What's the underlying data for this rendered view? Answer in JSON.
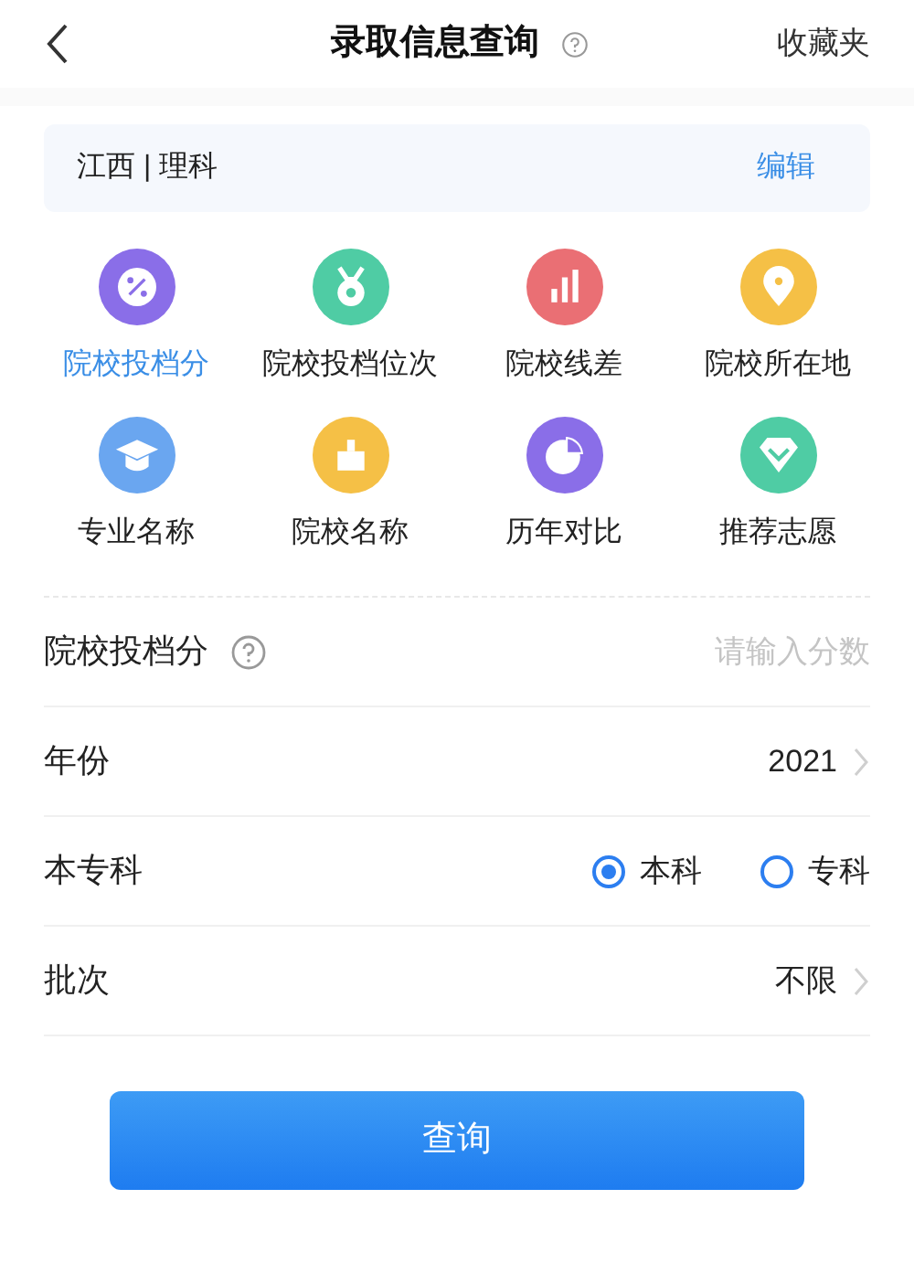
{
  "header": {
    "title": "录取信息查询",
    "favorites": "收藏夹"
  },
  "region": {
    "text": "江西 | 理科",
    "edit": "编辑"
  },
  "categories": [
    {
      "label": "院校投档分",
      "kind": "percent",
      "color": "#8a6ee8",
      "selected": true
    },
    {
      "label": "院校投档位次",
      "kind": "medal",
      "color": "#4fcca4",
      "selected": false
    },
    {
      "label": "院校线差",
      "kind": "chart",
      "color": "#ea6f74",
      "selected": false
    },
    {
      "label": "院校所在地",
      "kind": "pin",
      "color": "#f5c046",
      "selected": false
    },
    {
      "label": "专业名称",
      "kind": "cap",
      "color": "#6aa6f0",
      "selected": false
    },
    {
      "label": "院校名称",
      "kind": "castle",
      "color": "#f5c046",
      "selected": false
    },
    {
      "label": "历年对比",
      "kind": "pie",
      "color": "#8a6ee8",
      "selected": false
    },
    {
      "label": "推荐志愿",
      "kind": "diamond",
      "color": "#4fcca4",
      "selected": false
    }
  ],
  "form": [
    {
      "kind": "input",
      "label": "院校投档分",
      "placeholder": "请输入分数"
    },
    {
      "kind": "select",
      "label": "年份",
      "value": "2021"
    },
    {
      "kind": "radio",
      "label": "本专科",
      "options": [
        {
          "label": "本科",
          "selected": true
        },
        {
          "label": "专科",
          "selected": false
        }
      ]
    },
    {
      "kind": "select",
      "label": "批次",
      "value": "不限"
    }
  ],
  "submit": "查询"
}
